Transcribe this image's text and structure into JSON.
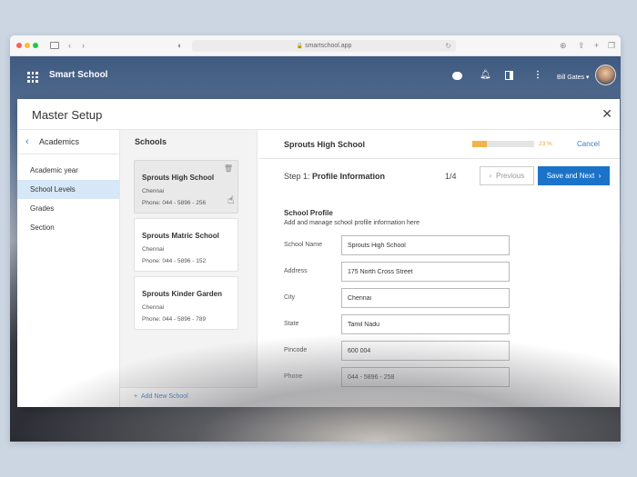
{
  "browser": {
    "url": "smartschool.app"
  },
  "app": {
    "title": "Smart School",
    "user": {
      "name": "Bill Gates ▾"
    }
  },
  "modal": {
    "title": "Master Setup",
    "close": "✕"
  },
  "sidebar": {
    "title": "Academics",
    "items": [
      {
        "label": "Academic year",
        "active": false
      },
      {
        "label": "School Levels",
        "active": true
      },
      {
        "label": "Grades",
        "active": false
      },
      {
        "label": "Section",
        "active": false
      }
    ]
  },
  "schools": {
    "title": "Schools",
    "list": [
      {
        "name": "Sprouts High School",
        "city": "Chennai",
        "phone": "Phone: 044 - 5896 - 256"
      },
      {
        "name": "Sprouts Matric School",
        "city": "Chennai",
        "phone": "Phone: 044 - 5896 - 152"
      },
      {
        "name": "Sprouts Kinder Garden",
        "city": "Chennai",
        "phone": "Phone: 044 - 5896 - 789"
      }
    ],
    "add_label": "Add New School"
  },
  "detail": {
    "school_title": "Sprouts High School",
    "progress_percent": 23,
    "progress_label": "23 %",
    "cancel_label": "Cancel",
    "step_prefix": "Step 1:",
    "step_name": "Profile Information",
    "step_count": "1/4",
    "previous_label": "Previous",
    "next_label": "Save and Next",
    "section_title": "School Profile",
    "section_subtitle": "Add and manage school profile information here",
    "fields": [
      {
        "label": "School Name",
        "value": "Sprouts High School"
      },
      {
        "label": "Address",
        "value": "175 North Cross Street"
      },
      {
        "label": "City",
        "value": "Chennai"
      },
      {
        "label": "State",
        "value": "Tamil Nadu"
      },
      {
        "label": "Pincode",
        "value": "600 004"
      },
      {
        "label": "Phone",
        "value": "044 - 5896 - 258"
      }
    ]
  },
  "colors": {
    "accent": "#1a73c8",
    "progress": "#f0b44c",
    "active_nav": "#d6e7f7"
  }
}
